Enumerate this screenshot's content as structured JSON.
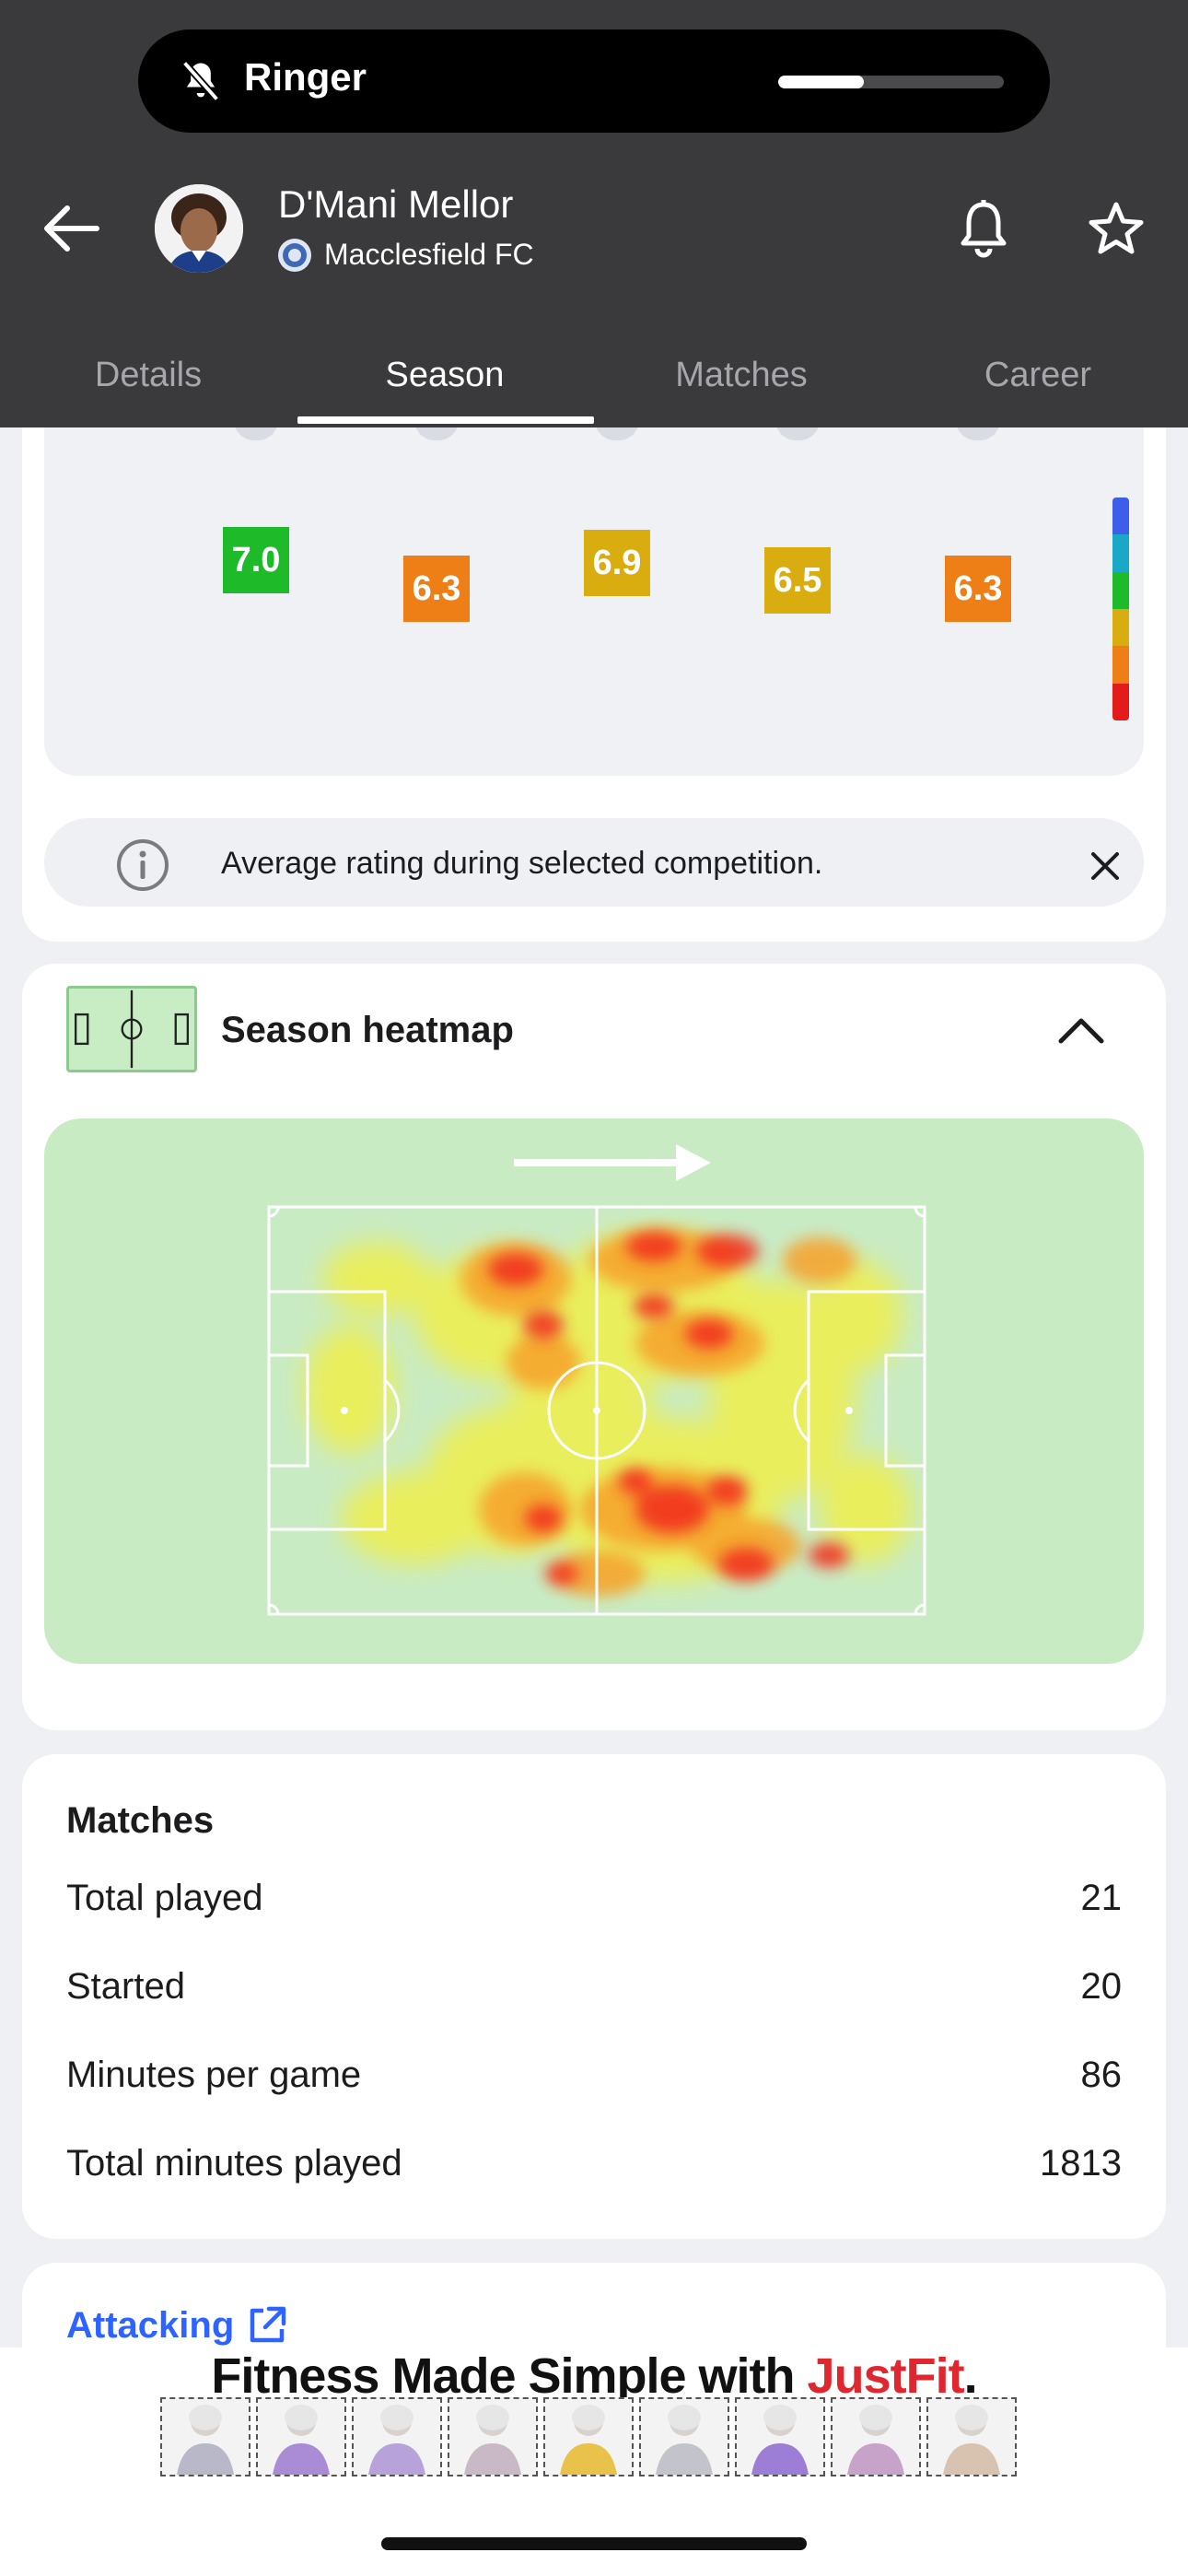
{
  "status": {
    "ringer_label": "Ringer",
    "volume_fraction": 0.38
  },
  "header": {
    "player_name": "D'Mani Mellor",
    "club_name": "Macclesfield FC",
    "icons": {
      "back": "arrow-left-icon",
      "notify": "bell-icon",
      "favorite": "star-icon"
    }
  },
  "tabs": [
    {
      "label": "Details",
      "active": false
    },
    {
      "label": "Season",
      "active": true
    },
    {
      "label": "Matches",
      "active": false
    },
    {
      "label": "Career",
      "active": false
    }
  ],
  "ratings": {
    "items": [
      {
        "value": "7.0",
        "color": "#1fba2a"
      },
      {
        "value": "6.3",
        "color": "#ee7f16"
      },
      {
        "value": "6.9",
        "color": "#d9ad0f"
      },
      {
        "value": "6.5",
        "color": "#d9ad0f"
      },
      {
        "value": "6.3",
        "color": "#ee7f16"
      }
    ],
    "scale_colors": [
      "#3d5ee8",
      "#19a9c7",
      "#1fba2a",
      "#d9ad0f",
      "#ee7f16",
      "#e31b1b"
    ],
    "info_text": "Average rating during selected competition."
  },
  "heatmap": {
    "title": "Season heatmap"
  },
  "matches": {
    "title": "Matches",
    "rows": [
      {
        "label": "Total played",
        "value": "21"
      },
      {
        "label": "Started",
        "value": "20"
      },
      {
        "label": "Minutes per game",
        "value": "86"
      },
      {
        "label": "Total minutes played",
        "value": "1813"
      }
    ]
  },
  "attacking": {
    "label": "Attacking"
  },
  "ad": {
    "headline_prefix": "Fitness Made Simple with ",
    "brand": "JustFit",
    "headline_suffix": "."
  }
}
